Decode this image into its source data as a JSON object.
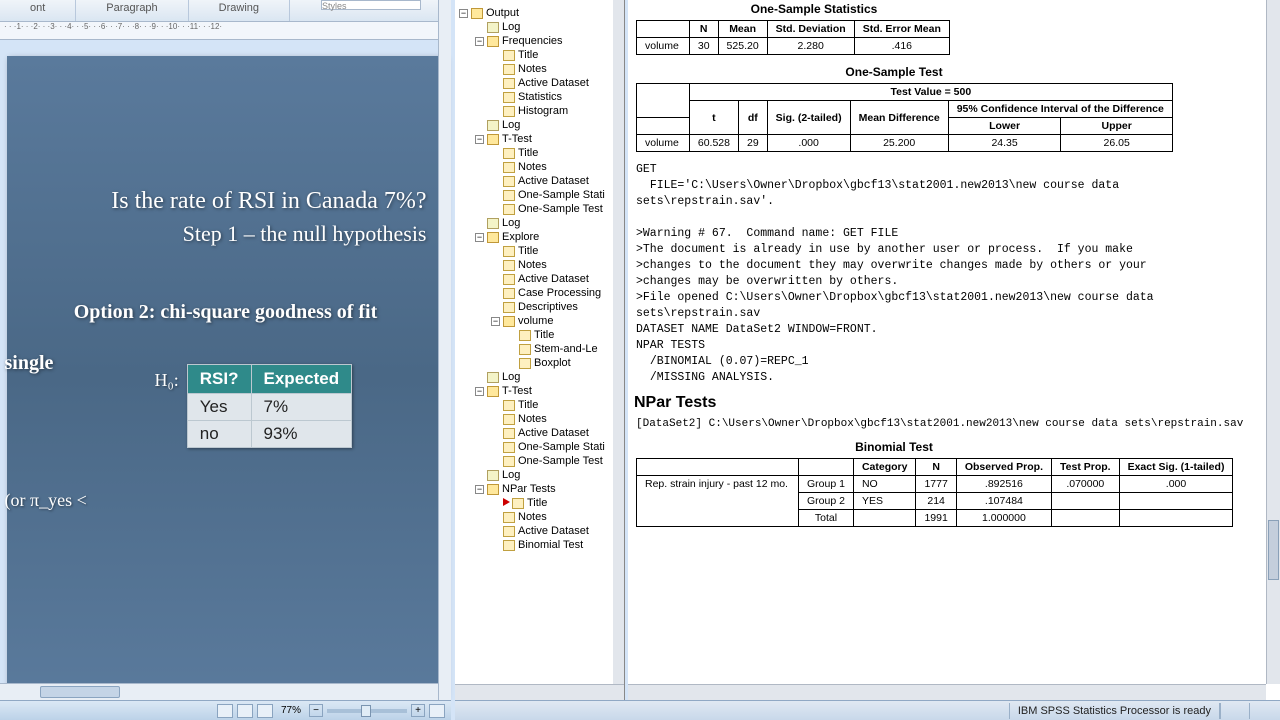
{
  "word": {
    "ribbon_groups": [
      "ont",
      "Paragraph",
      "Drawing"
    ],
    "styles_label": "Styles",
    "ruler_marks": "· · ·1· · ·2· · ·3· · ·4· · ·5· · ·6· · ·7· · ·8· · ·9· · ·10· · ·11· · ·12·",
    "zoom": "77%"
  },
  "slide": {
    "title": "Is the rate of RSI in Canada 7%?",
    "subtitle": "Step 1 – the null hypothesis",
    "single": "single",
    "option": "Option 2: chi-square goodness of fit",
    "h0": "H₀:",
    "pi_frag": "(or π_yes <",
    "table": {
      "head": [
        "RSI?",
        "Expected"
      ],
      "rows": [
        [
          "Yes",
          "7%"
        ],
        [
          "no",
          "93%"
        ]
      ]
    }
  },
  "tree": [
    {
      "d": 0,
      "t": "tog",
      "label": "Output",
      "icon": "folder"
    },
    {
      "d": 1,
      "t": "leaf",
      "label": "Log",
      "icon": "log"
    },
    {
      "d": 1,
      "t": "tog",
      "label": "Frequencies",
      "icon": "folder"
    },
    {
      "d": 2,
      "t": "leaf",
      "label": "Title",
      "icon": "doc"
    },
    {
      "d": 2,
      "t": "leaf",
      "label": "Notes",
      "icon": "doc"
    },
    {
      "d": 2,
      "t": "leaf",
      "label": "Active Dataset",
      "icon": "doc"
    },
    {
      "d": 2,
      "t": "leaf",
      "label": "Statistics",
      "icon": "doc"
    },
    {
      "d": 2,
      "t": "leaf",
      "label": "Histogram",
      "icon": "doc"
    },
    {
      "d": 1,
      "t": "leaf",
      "label": "Log",
      "icon": "log"
    },
    {
      "d": 1,
      "t": "tog",
      "label": "T-Test",
      "icon": "folder"
    },
    {
      "d": 2,
      "t": "leaf",
      "label": "Title",
      "icon": "doc"
    },
    {
      "d": 2,
      "t": "leaf",
      "label": "Notes",
      "icon": "doc"
    },
    {
      "d": 2,
      "t": "leaf",
      "label": "Active Dataset",
      "icon": "doc"
    },
    {
      "d": 2,
      "t": "leaf",
      "label": "One-Sample Stati",
      "icon": "doc"
    },
    {
      "d": 2,
      "t": "leaf",
      "label": "One-Sample Test",
      "icon": "doc"
    },
    {
      "d": 1,
      "t": "leaf",
      "label": "Log",
      "icon": "log"
    },
    {
      "d": 1,
      "t": "tog",
      "label": "Explore",
      "icon": "folder"
    },
    {
      "d": 2,
      "t": "leaf",
      "label": "Title",
      "icon": "doc"
    },
    {
      "d": 2,
      "t": "leaf",
      "label": "Notes",
      "icon": "doc"
    },
    {
      "d": 2,
      "t": "leaf",
      "label": "Active Dataset",
      "icon": "doc"
    },
    {
      "d": 2,
      "t": "leaf",
      "label": "Case Processing",
      "icon": "doc"
    },
    {
      "d": 2,
      "t": "leaf",
      "label": "Descriptives",
      "icon": "doc"
    },
    {
      "d": 2,
      "t": "tog",
      "label": "volume",
      "icon": "folder"
    },
    {
      "d": 3,
      "t": "leaf",
      "label": "Title",
      "icon": "doc"
    },
    {
      "d": 3,
      "t": "leaf",
      "label": "Stem-and-Le",
      "icon": "doc"
    },
    {
      "d": 3,
      "t": "leaf",
      "label": "Boxplot",
      "icon": "doc"
    },
    {
      "d": 1,
      "t": "leaf",
      "label": "Log",
      "icon": "log"
    },
    {
      "d": 1,
      "t": "tog",
      "label": "T-Test",
      "icon": "folder"
    },
    {
      "d": 2,
      "t": "leaf",
      "label": "Title",
      "icon": "doc"
    },
    {
      "d": 2,
      "t": "leaf",
      "label": "Notes",
      "icon": "doc"
    },
    {
      "d": 2,
      "t": "leaf",
      "label": "Active Dataset",
      "icon": "doc"
    },
    {
      "d": 2,
      "t": "leaf",
      "label": "One-Sample Stati",
      "icon": "doc"
    },
    {
      "d": 2,
      "t": "leaf",
      "label": "One-Sample Test",
      "icon": "doc"
    },
    {
      "d": 1,
      "t": "leaf",
      "label": "Log",
      "icon": "log"
    },
    {
      "d": 1,
      "t": "tog",
      "label": "NPar Tests",
      "icon": "folder"
    },
    {
      "d": 2,
      "t": "leaf",
      "label": "Title",
      "icon": "doc",
      "cur": true
    },
    {
      "d": 2,
      "t": "leaf",
      "label": "Notes",
      "icon": "doc"
    },
    {
      "d": 2,
      "t": "leaf",
      "label": "Active Dataset",
      "icon": "doc"
    },
    {
      "d": 2,
      "t": "leaf",
      "label": "Binomial Test",
      "icon": "doc"
    }
  ],
  "output": {
    "oneSampleStats": {
      "title": "One-Sample Statistics",
      "headers": [
        "",
        "N",
        "Mean",
        "Std. Deviation",
        "Std. Error Mean"
      ],
      "row": [
        "volume",
        "30",
        "525.20",
        "2.280",
        ".416"
      ]
    },
    "oneSampleTest": {
      "title": "One-Sample Test",
      "testValue": "Test Value = 500",
      "ciLabel": "95% Confidence Interval of the Difference",
      "headers": [
        "",
        "t",
        "df",
        "Sig. (2-tailed)",
        "Mean Difference",
        "Lower",
        "Upper"
      ],
      "row": [
        "volume",
        "60.528",
        "29",
        ".000",
        "25.200",
        "24.35",
        "26.05"
      ]
    },
    "syntax": "GET\n  FILE='C:\\Users\\Owner\\Dropbox\\gbcf13\\stat2001.new2013\\new course data sets\\repstrain.sav'.\n\n>Warning # 67.  Command name: GET FILE\n>The document is already in use by another user or process.  If you make\n>changes to the document they may overwrite changes made by others or your\n>changes may be overwritten by others.\n>File opened C:\\Users\\Owner\\Dropbox\\gbcf13\\stat2001.new2013\\new course data sets\\repstrain.sav\nDATASET NAME DataSet2 WINDOW=FRONT.\nNPAR TESTS\n  /BINOMIAL (0.07)=REPC_1\n  /MISSING ANALYSIS.",
    "npar": {
      "heading": "NPar Tests",
      "dataset": "[DataSet2] C:\\Users\\Owner\\Dropbox\\gbcf13\\stat2001.new2013\\new course data sets\\repstrain.sav"
    },
    "binomial": {
      "title": "Binomial Test",
      "headers": [
        "",
        "",
        "Category",
        "N",
        "Observed Prop.",
        "Test Prop.",
        "Exact Sig. (1-tailed)"
      ],
      "rows": [
        [
          "Rep. strain injury - past 12 mo.",
          "Group 1",
          "NO",
          "1777",
          ".892516",
          ".070000",
          ".000"
        ],
        [
          "",
          "Group 2",
          "YES",
          "214",
          ".107484",
          "",
          ""
        ],
        [
          "",
          "Total",
          "",
          "1991",
          "1.000000",
          "",
          ""
        ]
      ]
    }
  },
  "status": "IBM SPSS Statistics Processor is ready"
}
